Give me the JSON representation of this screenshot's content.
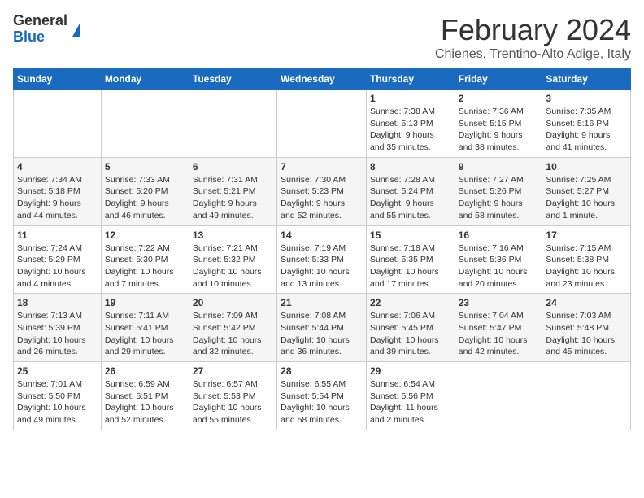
{
  "header": {
    "logo_general": "General",
    "logo_blue": "Blue",
    "month_title": "February 2024",
    "location": "Chienes, Trentino-Alto Adige, Italy"
  },
  "weekdays": [
    "Sunday",
    "Monday",
    "Tuesday",
    "Wednesday",
    "Thursday",
    "Friday",
    "Saturday"
  ],
  "weeks": [
    [
      {
        "day": "",
        "info": ""
      },
      {
        "day": "",
        "info": ""
      },
      {
        "day": "",
        "info": ""
      },
      {
        "day": "",
        "info": ""
      },
      {
        "day": "1",
        "info": "Sunrise: 7:38 AM\nSunset: 5:13 PM\nDaylight: 9 hours\nand 35 minutes."
      },
      {
        "day": "2",
        "info": "Sunrise: 7:36 AM\nSunset: 5:15 PM\nDaylight: 9 hours\nand 38 minutes."
      },
      {
        "day": "3",
        "info": "Sunrise: 7:35 AM\nSunset: 5:16 PM\nDaylight: 9 hours\nand 41 minutes."
      }
    ],
    [
      {
        "day": "4",
        "info": "Sunrise: 7:34 AM\nSunset: 5:18 PM\nDaylight: 9 hours\nand 44 minutes."
      },
      {
        "day": "5",
        "info": "Sunrise: 7:33 AM\nSunset: 5:20 PM\nDaylight: 9 hours\nand 46 minutes."
      },
      {
        "day": "6",
        "info": "Sunrise: 7:31 AM\nSunset: 5:21 PM\nDaylight: 9 hours\nand 49 minutes."
      },
      {
        "day": "7",
        "info": "Sunrise: 7:30 AM\nSunset: 5:23 PM\nDaylight: 9 hours\nand 52 minutes."
      },
      {
        "day": "8",
        "info": "Sunrise: 7:28 AM\nSunset: 5:24 PM\nDaylight: 9 hours\nand 55 minutes."
      },
      {
        "day": "9",
        "info": "Sunrise: 7:27 AM\nSunset: 5:26 PM\nDaylight: 9 hours\nand 58 minutes."
      },
      {
        "day": "10",
        "info": "Sunrise: 7:25 AM\nSunset: 5:27 PM\nDaylight: 10 hours\nand 1 minute."
      }
    ],
    [
      {
        "day": "11",
        "info": "Sunrise: 7:24 AM\nSunset: 5:29 PM\nDaylight: 10 hours\nand 4 minutes."
      },
      {
        "day": "12",
        "info": "Sunrise: 7:22 AM\nSunset: 5:30 PM\nDaylight: 10 hours\nand 7 minutes."
      },
      {
        "day": "13",
        "info": "Sunrise: 7:21 AM\nSunset: 5:32 PM\nDaylight: 10 hours\nand 10 minutes."
      },
      {
        "day": "14",
        "info": "Sunrise: 7:19 AM\nSunset: 5:33 PM\nDaylight: 10 hours\nand 13 minutes."
      },
      {
        "day": "15",
        "info": "Sunrise: 7:18 AM\nSunset: 5:35 PM\nDaylight: 10 hours\nand 17 minutes."
      },
      {
        "day": "16",
        "info": "Sunrise: 7:16 AM\nSunset: 5:36 PM\nDaylight: 10 hours\nand 20 minutes."
      },
      {
        "day": "17",
        "info": "Sunrise: 7:15 AM\nSunset: 5:38 PM\nDaylight: 10 hours\nand 23 minutes."
      }
    ],
    [
      {
        "day": "18",
        "info": "Sunrise: 7:13 AM\nSunset: 5:39 PM\nDaylight: 10 hours\nand 26 minutes."
      },
      {
        "day": "19",
        "info": "Sunrise: 7:11 AM\nSunset: 5:41 PM\nDaylight: 10 hours\nand 29 minutes."
      },
      {
        "day": "20",
        "info": "Sunrise: 7:09 AM\nSunset: 5:42 PM\nDaylight: 10 hours\nand 32 minutes."
      },
      {
        "day": "21",
        "info": "Sunrise: 7:08 AM\nSunset: 5:44 PM\nDaylight: 10 hours\nand 36 minutes."
      },
      {
        "day": "22",
        "info": "Sunrise: 7:06 AM\nSunset: 5:45 PM\nDaylight: 10 hours\nand 39 minutes."
      },
      {
        "day": "23",
        "info": "Sunrise: 7:04 AM\nSunset: 5:47 PM\nDaylight: 10 hours\nand 42 minutes."
      },
      {
        "day": "24",
        "info": "Sunrise: 7:03 AM\nSunset: 5:48 PM\nDaylight: 10 hours\nand 45 minutes."
      }
    ],
    [
      {
        "day": "25",
        "info": "Sunrise: 7:01 AM\nSunset: 5:50 PM\nDaylight: 10 hours\nand 49 minutes."
      },
      {
        "day": "26",
        "info": "Sunrise: 6:59 AM\nSunset: 5:51 PM\nDaylight: 10 hours\nand 52 minutes."
      },
      {
        "day": "27",
        "info": "Sunrise: 6:57 AM\nSunset: 5:53 PM\nDaylight: 10 hours\nand 55 minutes."
      },
      {
        "day": "28",
        "info": "Sunrise: 6:55 AM\nSunset: 5:54 PM\nDaylight: 10 hours\nand 58 minutes."
      },
      {
        "day": "29",
        "info": "Sunrise: 6:54 AM\nSunset: 5:56 PM\nDaylight: 11 hours\nand 2 minutes."
      },
      {
        "day": "",
        "info": ""
      },
      {
        "day": "",
        "info": ""
      }
    ]
  ]
}
